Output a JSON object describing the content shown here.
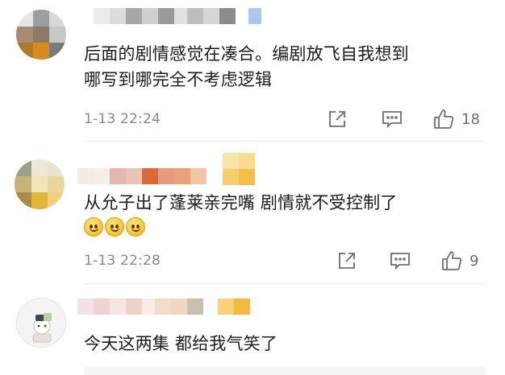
{
  "comments": [
    {
      "text_lines": [
        "后面的剧情感觉在凑合。编剧放飞自我想到",
        "哪写到哪完全不考虑逻辑"
      ],
      "timestamp": "1-13 22:24",
      "likes": "18",
      "has_emojis": false
    },
    {
      "text_lines": [
        "从允子出了蓬莱亲完嘴 剧情就不受控制了"
      ],
      "timestamp": "1-13 22:28",
      "likes": "9",
      "has_emojis": true
    },
    {
      "text_lines": [
        "今天这两集 都给我气笑了"
      ],
      "timestamp": "",
      "likes": "",
      "has_emojis": false
    }
  ],
  "icons": {
    "share": "share-icon",
    "comment": "comment-icon",
    "like": "thumbs-up-icon"
  },
  "colors": {
    "text": "#1c1c1c",
    "meta": "#8a8a8a",
    "icon": "#6e6e6e",
    "divider": "#ececec"
  }
}
